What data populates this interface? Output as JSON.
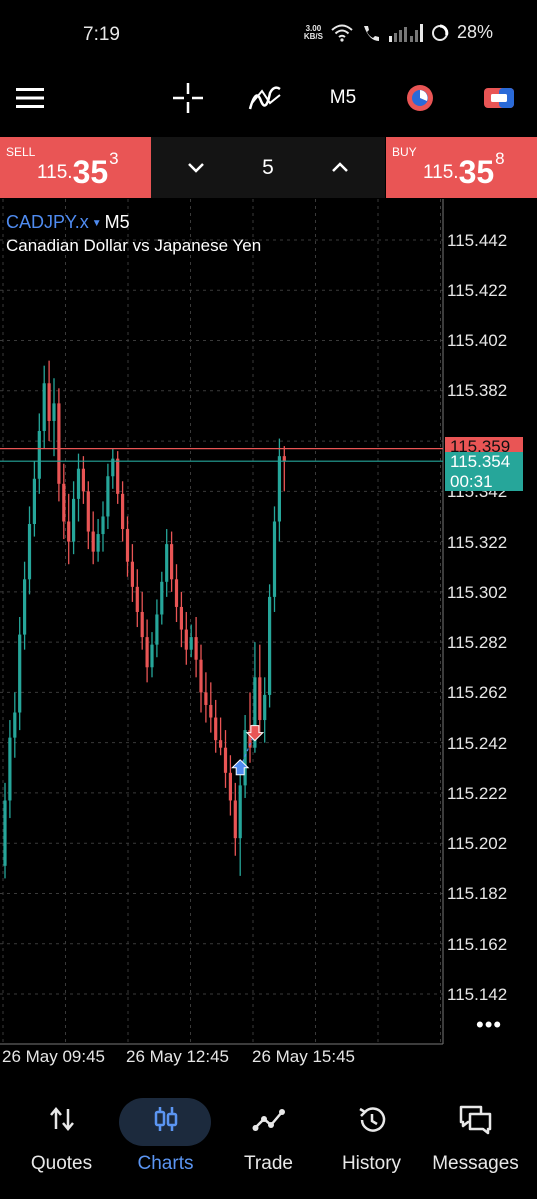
{
  "status": {
    "time": "7:19",
    "speed_value": "3.00",
    "speed_unit": "KB/S",
    "battery": "28%"
  },
  "toolbar": {
    "timeframe": "M5"
  },
  "trade": {
    "sell_label": "SELL",
    "sell_small": "115.",
    "sell_big": "35",
    "sell_sup": "3",
    "buy_label": "BUY",
    "buy_small": "115.",
    "buy_big": "35",
    "buy_sup": "8",
    "lot": "5"
  },
  "chart": {
    "symbol": "CADJPY.x",
    "timeframe": "M5",
    "description": "Canadian Dollar vs Japanese Yen",
    "price_ask": "115.359",
    "price_bid": "115.354",
    "countdown": "00:31",
    "y_labels": [
      "115.442",
      "115.422",
      "115.402",
      "115.382",
      "115.342",
      "115.322",
      "115.302",
      "115.282",
      "115.262",
      "115.242",
      "115.222",
      "115.202",
      "115.182",
      "115.162",
      "115.142"
    ],
    "x_labels": [
      "26 May 09:45",
      "26 May 12:45",
      "26 May 15:45"
    ],
    "more": "•••"
  },
  "chart_data": {
    "type": "candlestick",
    "xlabel": "",
    "ylabel": "",
    "ylim": [
      115.136,
      115.452
    ],
    "x": [
      "26 May 09:45",
      "26 May 12:45",
      "26 May 15:45"
    ],
    "series": [
      {
        "name": "",
        "candles": [
          [
            115.193,
            115.226,
            115.188,
            115.219
          ],
          [
            115.219,
            115.251,
            115.212,
            115.244
          ],
          [
            115.244,
            115.262,
            115.236,
            115.254
          ],
          [
            115.254,
            115.292,
            115.247,
            115.285
          ],
          [
            115.285,
            115.314,
            115.279,
            115.307
          ],
          [
            115.307,
            115.336,
            115.301,
            115.329
          ],
          [
            115.329,
            115.354,
            115.324,
            115.347
          ],
          [
            115.347,
            115.373,
            115.341,
            115.366
          ],
          [
            115.366,
            115.392,
            115.359,
            115.385
          ],
          [
            115.385,
            115.394,
            115.362,
            115.37
          ],
          [
            115.37,
            115.387,
            115.356,
            115.377
          ],
          [
            115.377,
            115.383,
            115.338,
            115.345
          ],
          [
            115.345,
            115.353,
            115.323,
            115.33
          ],
          [
            115.33,
            115.341,
            115.313,
            115.322
          ],
          [
            115.322,
            115.346,
            115.317,
            115.339
          ],
          [
            115.339,
            115.357,
            115.33,
            115.351
          ],
          [
            115.351,
            115.356,
            115.337,
            115.342
          ],
          [
            115.342,
            115.346,
            115.319,
            115.326
          ],
          [
            115.326,
            115.334,
            115.313,
            115.318
          ],
          [
            115.318,
            115.331,
            115.314,
            115.325
          ],
          [
            115.325,
            115.338,
            115.318,
            115.332
          ],
          [
            115.332,
            115.353,
            115.327,
            115.348
          ],
          [
            115.348,
            115.359,
            115.343,
            115.355
          ],
          [
            115.355,
            115.358,
            115.337,
            115.341
          ],
          [
            115.341,
            115.346,
            115.322,
            115.327
          ],
          [
            115.327,
            115.332,
            115.308,
            115.314
          ],
          [
            115.314,
            115.321,
            115.298,
            115.304
          ],
          [
            115.304,
            115.311,
            115.288,
            115.294
          ],
          [
            115.294,
            115.302,
            115.279,
            115.284
          ],
          [
            115.284,
            115.291,
            115.266,
            115.272
          ],
          [
            115.272,
            115.286,
            115.268,
            115.281
          ],
          [
            115.281,
            115.299,
            115.276,
            115.293
          ],
          [
            115.293,
            115.31,
            115.289,
            115.306
          ],
          [
            115.306,
            115.327,
            115.3,
            115.321
          ],
          [
            115.321,
            115.326,
            115.302,
            115.307
          ],
          [
            115.307,
            115.313,
            115.29,
            115.296
          ],
          [
            115.296,
            115.302,
            115.28,
            115.287
          ],
          [
            115.287,
            115.294,
            115.273,
            115.279
          ],
          [
            115.279,
            115.289,
            115.276,
            115.284
          ],
          [
            115.284,
            115.292,
            115.268,
            115.275
          ],
          [
            115.275,
            115.281,
            115.254,
            115.262
          ],
          [
            115.262,
            115.27,
            115.25,
            115.257
          ],
          [
            115.257,
            115.266,
            115.246,
            115.252
          ],
          [
            115.252,
            115.259,
            115.238,
            115.243
          ],
          [
            115.243,
            115.252,
            115.237,
            115.24
          ],
          [
            115.24,
            115.247,
            115.224,
            115.23
          ],
          [
            115.23,
            115.237,
            115.213,
            115.219
          ],
          [
            115.219,
            115.226,
            115.197,
            115.204
          ],
          [
            115.204,
            115.231,
            115.189,
            115.225
          ],
          [
            115.225,
            115.253,
            115.22,
            115.247
          ],
          [
            115.247,
            115.262,
            115.234,
            115.24
          ],
          [
            115.24,
            115.282,
            115.238,
            115.268
          ],
          [
            115.268,
            115.281,
            115.245,
            115.251
          ],
          [
            115.251,
            115.268,
            115.242,
            115.261
          ],
          [
            115.261,
            115.305,
            115.256,
            115.3
          ],
          [
            115.3,
            115.336,
            115.294,
            115.33
          ],
          [
            115.33,
            115.363,
            115.322,
            115.356
          ],
          [
            115.356,
            115.36,
            115.342,
            115.354
          ]
        ]
      }
    ],
    "horizontal_lines": [
      {
        "value": 115.359,
        "color": "#e95555"
      },
      {
        "value": 115.354,
        "color": "#26a69a"
      }
    ],
    "markers": [
      {
        "type": "buy",
        "index": 48,
        "value": 115.232,
        "color": "#4f8bf0"
      },
      {
        "type": "sell",
        "index": 51,
        "value": 115.246,
        "color": "#e95555"
      }
    ],
    "colors": {
      "up": "#26a69a",
      "down": "#e95555",
      "grid": "#3a3a3a",
      "background": "#000000"
    }
  },
  "nav": {
    "items": [
      {
        "label": "Quotes"
      },
      {
        "label": "Charts"
      },
      {
        "label": "Trade"
      },
      {
        "label": "History"
      },
      {
        "label": "Messages"
      }
    ]
  }
}
